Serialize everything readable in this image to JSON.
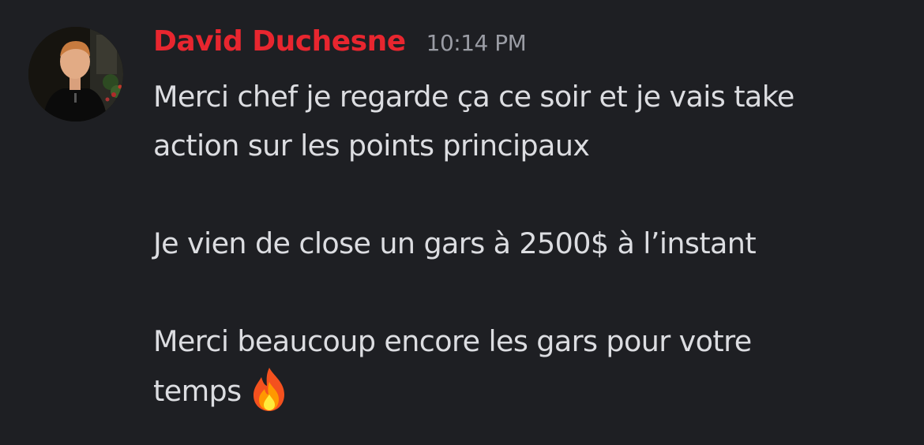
{
  "message": {
    "author": "David Duchesne",
    "timestamp": "10:14 PM",
    "lines": {
      "l1": "Merci chef je regarde ça ce soir et je vais take",
      "l2": "action sur les points principaux",
      "l3": "Je vien de close un gars à 2500$ à l’instant",
      "l4": "Merci beaucoup encore les gars pour votre",
      "l5": "temps"
    },
    "emoji": "fire-emoji"
  },
  "colors": {
    "background": "#1e1f23",
    "author": "#e8262f",
    "timestamp": "#9a9ca4",
    "text": "#dcdde1"
  }
}
